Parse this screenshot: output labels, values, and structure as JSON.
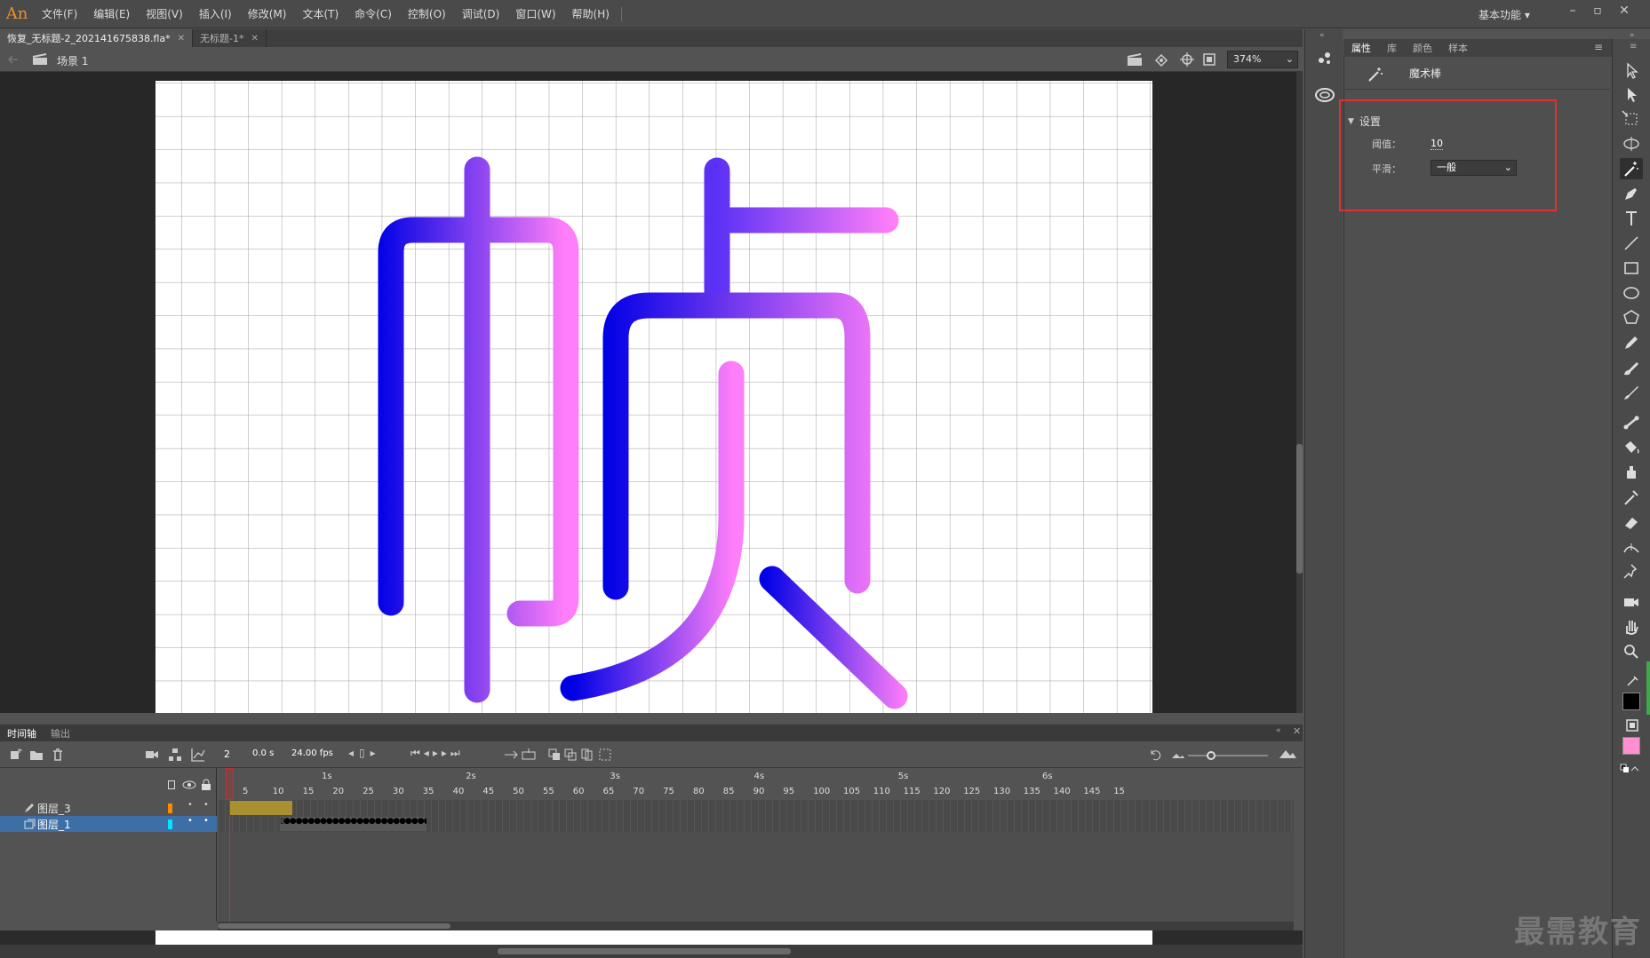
{
  "app": {
    "logo": "An"
  },
  "menu": [
    "文件(F)",
    "编辑(E)",
    "视图(V)",
    "插入(I)",
    "修改(M)",
    "文本(T)",
    "命令(C)",
    "控制(O)",
    "调试(D)",
    "窗口(W)",
    "帮助(H)"
  ],
  "workspace": "基本功能",
  "doc_tabs": [
    {
      "label": "恢复_无标题-2_202141675838.fla*",
      "active": true
    },
    {
      "label": "无标题-1*",
      "active": false
    }
  ],
  "editbar": {
    "scene": "场景 1",
    "zoom": "374%"
  },
  "props_panel": {
    "tabs": [
      "属性",
      "库",
      "颜色",
      "样本"
    ],
    "tool_name": "魔术棒",
    "section": "设置",
    "threshold_label": "阈值：",
    "threshold_value": "10",
    "smooth_label": "平滑：",
    "smooth_value": "一般"
  },
  "timeline": {
    "tabs": [
      "时间轴",
      "输出"
    ],
    "current_frame": "2",
    "time": "0.0 s",
    "fps": "24.00 fps",
    "layers": [
      {
        "name": "图层_3",
        "color": "#ff8c00",
        "selected": false
      },
      {
        "name": "图层_1",
        "color": "#00e5ff",
        "selected": true
      }
    ],
    "frame_ticks": [
      "5",
      "10",
      "15",
      "20",
      "25",
      "30",
      "35",
      "40",
      "45",
      "50",
      "55",
      "60",
      "65",
      "70",
      "75",
      "80",
      "85",
      "90",
      "95",
      "100",
      "105",
      "110",
      "115",
      "120",
      "125",
      "130",
      "135",
      "140",
      "145",
      "15"
    ],
    "second_ticks": [
      "1s",
      "2s",
      "3s",
      "4s",
      "5s",
      "6s"
    ]
  },
  "colors": {
    "gradient_start": "#0000e6",
    "gradient_end": "#ff7ef9",
    "layer3_frames": "#a89030",
    "stroke_swatch": "#000000",
    "fill_swatch": "#ff8fd0"
  },
  "watermark": "最需教育"
}
